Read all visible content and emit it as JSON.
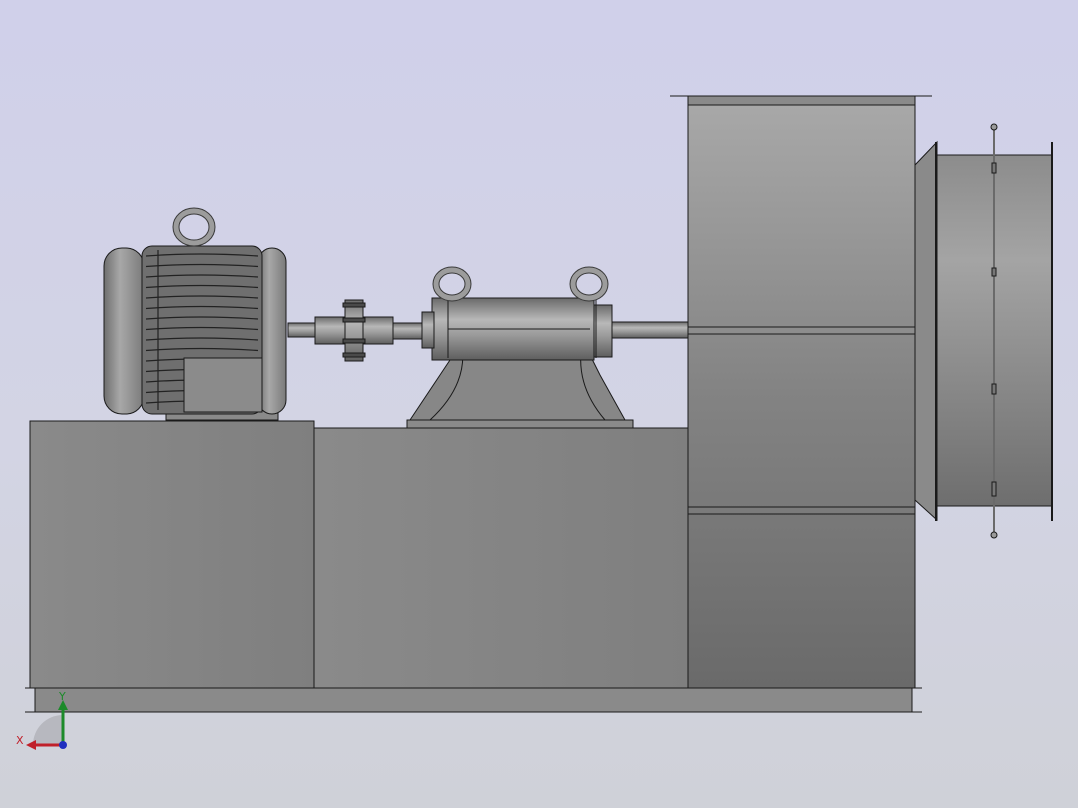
{
  "viewport": {
    "background_top": "#d0d0ea",
    "background_bottom": "#cfd1d8"
  },
  "model": {
    "view": "side elevation",
    "components": [
      "motor",
      "coupling",
      "bearing-housing",
      "fan-housing",
      "inlet-box",
      "base-frame"
    ],
    "body_color": "#858585",
    "edge_color": "#1a1a1a"
  },
  "triad": {
    "x_label": "X",
    "y_label": "Y",
    "x_color": "#c0202a",
    "y_color": "#1c8a2a",
    "z_color": "#1f2fbf"
  }
}
